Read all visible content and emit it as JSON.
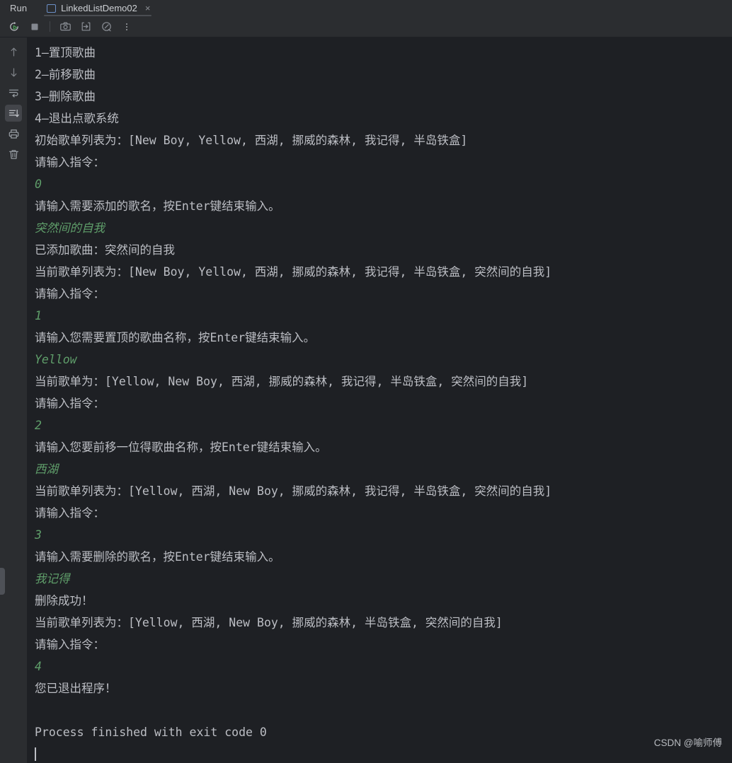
{
  "window": {
    "tool_window_title": "Run"
  },
  "tab": {
    "label": "LinkedListDemo02",
    "close_label": "×",
    "icon": "run-configuration-icon"
  },
  "toolbar": {
    "buttons": [
      {
        "name": "rerun-button",
        "icon": "rerun-icon",
        "tooltip": "Rerun"
      },
      {
        "name": "stop-button",
        "icon": "stop-icon",
        "tooltip": "Stop"
      },
      {
        "name": "screenshot-button",
        "icon": "camera-icon",
        "tooltip": "Screenshot"
      },
      {
        "name": "thread-dump-button",
        "icon": "arrow-into-box-icon",
        "tooltip": "Get Thread Dump"
      },
      {
        "name": "profiler-button",
        "icon": "gauge-icon",
        "tooltip": "Profiler"
      },
      {
        "name": "more-button",
        "icon": "more-vertical-icon",
        "tooltip": "More"
      }
    ]
  },
  "gutter": {
    "buttons": [
      {
        "name": "up-button",
        "icon": "arrow-up-icon",
        "tooltip": "Up"
      },
      {
        "name": "down-button",
        "icon": "arrow-down-icon",
        "tooltip": "Down"
      },
      {
        "name": "soft-wrap-button",
        "icon": "soft-wrap-icon",
        "tooltip": "Soft-Wrap"
      },
      {
        "name": "scroll-to-end-button",
        "icon": "scroll-to-end-icon",
        "tooltip": "Scroll to End",
        "selected": true
      },
      {
        "name": "print-button",
        "icon": "printer-icon",
        "tooltip": "Print"
      },
      {
        "name": "clear-button",
        "icon": "trash-icon",
        "tooltip": "Clear All"
      }
    ]
  },
  "colors": {
    "console_bg": "#1e2024",
    "chrome_bg": "#2b2d30",
    "output_text": "#bcbec4",
    "input_text": "#5f9e6a",
    "tab_icon_accent": "#6c8fc7",
    "run_accent": "#499c54"
  },
  "console": {
    "lines": [
      {
        "text": "1—置顶歌曲",
        "kind": "output"
      },
      {
        "text": "2—前移歌曲",
        "kind": "output"
      },
      {
        "text": "3—删除歌曲",
        "kind": "output"
      },
      {
        "text": "4—退出点歌系统",
        "kind": "output"
      },
      {
        "text": "初始歌单列表为：[New Boy, Yellow, 西湖, 挪威的森林, 我记得, 半岛铁盒]",
        "kind": "output"
      },
      {
        "text": "请输入指令：",
        "kind": "output"
      },
      {
        "text": "0",
        "kind": "input"
      },
      {
        "text": "请输入需要添加的歌名，按Enter键结束输入。",
        "kind": "output"
      },
      {
        "text": "突然间的自我",
        "kind": "input"
      },
      {
        "text": "已添加歌曲：突然间的自我",
        "kind": "output"
      },
      {
        "text": "当前歌单列表为：[New Boy, Yellow, 西湖, 挪威的森林, 我记得, 半岛铁盒, 突然间的自我]",
        "kind": "output"
      },
      {
        "text": "请输入指令：",
        "kind": "output"
      },
      {
        "text": "1",
        "kind": "input"
      },
      {
        "text": "请输入您需要置顶的歌曲名称，按Enter键结束输入。",
        "kind": "output"
      },
      {
        "text": "Yellow",
        "kind": "input"
      },
      {
        "text": "当前歌单为：[Yellow, New Boy, 西湖, 挪威的森林, 我记得, 半岛铁盒, 突然间的自我]",
        "kind": "output"
      },
      {
        "text": "请输入指令：",
        "kind": "output"
      },
      {
        "text": "2",
        "kind": "input"
      },
      {
        "text": "请输入您要前移一位得歌曲名称，按Enter键结束输入。",
        "kind": "output"
      },
      {
        "text": "西湖",
        "kind": "input"
      },
      {
        "text": "当前歌单列表为：[Yellow, 西湖, New Boy, 挪威的森林, 我记得, 半岛铁盒, 突然间的自我]",
        "kind": "output"
      },
      {
        "text": "请输入指令：",
        "kind": "output"
      },
      {
        "text": "3",
        "kind": "input"
      },
      {
        "text": "请输入需要删除的歌名，按Enter键结束输入。",
        "kind": "output"
      },
      {
        "text": "我记得",
        "kind": "input"
      },
      {
        "text": "删除成功！",
        "kind": "output"
      },
      {
        "text": "当前歌单列表为：[Yellow, 西湖, New Boy, 挪威的森林, 半岛铁盒, 突然间的自我]",
        "kind": "output"
      },
      {
        "text": "请输入指令：",
        "kind": "output"
      },
      {
        "text": "4",
        "kind": "input"
      },
      {
        "text": "您已退出程序！",
        "kind": "output"
      },
      {
        "text": " ",
        "kind": "blank"
      },
      {
        "text": "Process finished with exit code 0",
        "kind": "output"
      }
    ]
  },
  "watermark": {
    "text": "CSDN @喻师傅"
  }
}
